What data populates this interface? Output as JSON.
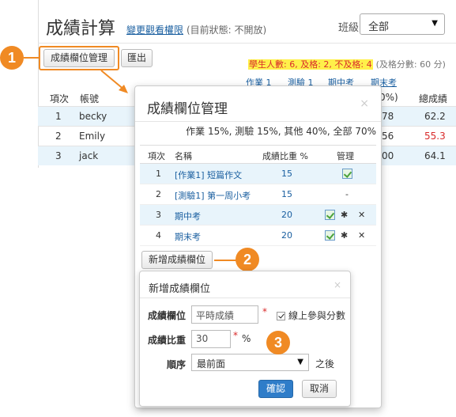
{
  "page": {
    "title": "成績計算",
    "perm_link": "變更觀看權限",
    "perm_status": "(目前狀態: 不開放)",
    "class_label": "班級",
    "class_value": "全部"
  },
  "toolbar": {
    "manage_label": "成績欄位管理",
    "export_label": "匯出"
  },
  "stats": {
    "summary": "學生人數: 6, 及格: 2, 不及格: 4",
    "pass_score": "(及格分數: 60 分)"
  },
  "grade_table": {
    "category_headers": [
      "作業 1",
      "測驗 1",
      "期中考",
      "期末考"
    ],
    "partial_pct": "0%)",
    "headers": {
      "index": "項次",
      "account": "帳號",
      "total": "總成績"
    },
    "rows": [
      {
        "index": "1",
        "account": "becky",
        "partial": "78",
        "total": "62.2",
        "fail": false
      },
      {
        "index": "2",
        "account": "Emily",
        "partial": "56",
        "total": "55.3",
        "fail": true
      },
      {
        "index": "3",
        "account": "jack",
        "partial": "00",
        "total": "64.1",
        "fail": false
      }
    ]
  },
  "callouts": [
    "1",
    "2",
    "3"
  ],
  "manage_dialog": {
    "title": "成績欄位管理",
    "close": "×",
    "summary": "作業 15%, 測驗 15%, 其他 40%, 全部 70%",
    "headers": {
      "index": "項次",
      "name": "名稱",
      "weight": "成績比重 %",
      "manage": "管理"
    },
    "rows": [
      {
        "index": "1",
        "name": "[作業1] 短篇作文",
        "weight": "15",
        "manage": "edit"
      },
      {
        "index": "2",
        "name": "[測驗1] 第一周小考",
        "weight": "15",
        "manage": "-"
      },
      {
        "index": "3",
        "name": "期中考",
        "weight": "20",
        "manage": "edit,settings,delete"
      },
      {
        "index": "4",
        "name": "期末考",
        "weight": "20",
        "manage": "edit,settings,delete"
      }
    ],
    "add_label": "新增成績欄位"
  },
  "add_dialog": {
    "title": "新增成績欄位",
    "close": "×",
    "field_label": "成績欄位",
    "field_value": "平時成績",
    "online_label": "線上參與分數",
    "online_checked": true,
    "weight_label": "成績比重",
    "weight_value": "30",
    "weight_unit": "%",
    "order_label": "順序",
    "order_value": "最前面",
    "order_suffix": "之後",
    "ok_label": "確認",
    "cancel_label": "取消",
    "required_mark": "*"
  },
  "colors": {
    "accent": "#f08a24",
    "link": "#1a5fa0",
    "fail_red": "#d92b2b",
    "highlight": "#fff04a",
    "primary_button": "#2f7dc9"
  }
}
